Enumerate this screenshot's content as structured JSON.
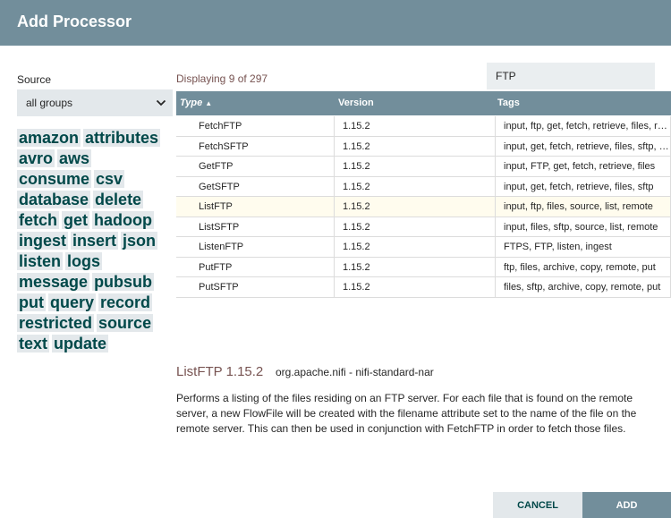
{
  "dialog": {
    "title": "Add Processor"
  },
  "source": {
    "label": "Source",
    "selected": "all groups"
  },
  "tag_cloud": [
    "amazon",
    "attributes",
    "avro",
    "aws",
    "consume",
    "csv",
    "database",
    "delete",
    "fetch",
    "get",
    "hadoop",
    "ingest",
    "insert",
    "json",
    "listen",
    "logs",
    "message",
    "pubsub",
    "put",
    "query",
    "record",
    "restricted",
    "source",
    "text",
    "update"
  ],
  "results": {
    "displaying": "Displaying 9 of 297"
  },
  "filter": {
    "value": "FTP"
  },
  "grid": {
    "columns": {
      "type": "Type",
      "version": "Version",
      "tags": "Tags"
    },
    "sort_indicator": "▲",
    "rows": [
      {
        "type": "FetchFTP",
        "version": "1.15.2",
        "tags": "input, ftp, get, fetch, retrieve, files, remote"
      },
      {
        "type": "FetchSFTP",
        "version": "1.15.2",
        "tags": "input, get, fetch, retrieve, files, sftp, remote"
      },
      {
        "type": "GetFTP",
        "version": "1.15.2",
        "tags": "input, FTP, get, fetch, retrieve, files"
      },
      {
        "type": "GetSFTP",
        "version": "1.15.2",
        "tags": "input, get, fetch, retrieve, files, sftp"
      },
      {
        "type": "ListFTP",
        "version": "1.15.2",
        "tags": "input, ftp, files, source, list, remote",
        "selected": true
      },
      {
        "type": "ListSFTP",
        "version": "1.15.2",
        "tags": "input, files, sftp, source, list, remote"
      },
      {
        "type": "ListenFTP",
        "version": "1.15.2",
        "tags": "FTPS, FTP, listen, ingest"
      },
      {
        "type": "PutFTP",
        "version": "1.15.2",
        "tags": "ftp, files, archive, copy, remote, put"
      },
      {
        "type": "PutSFTP",
        "version": "1.15.2",
        "tags": "files, sftp, archive, copy, remote, put"
      }
    ]
  },
  "detail": {
    "name": "ListFTP 1.15.2",
    "bundle": "org.apache.nifi - nifi-standard-nar",
    "description": "Performs a listing of the files residing on an FTP server. For each file that is found on the remote server, a new FlowFile will be created with the filename attribute set to the name of the file on the remote server. This can then be used in conjunction with FetchFTP in order to fetch those files."
  },
  "buttons": {
    "cancel": "CANCEL",
    "add": "ADD"
  },
  "colors": {
    "header": "#728e9b",
    "tag_bg": "#e3e8eb",
    "tag_text": "#004849",
    "accent_text": "#775351",
    "selected_row": "#fffcee"
  }
}
